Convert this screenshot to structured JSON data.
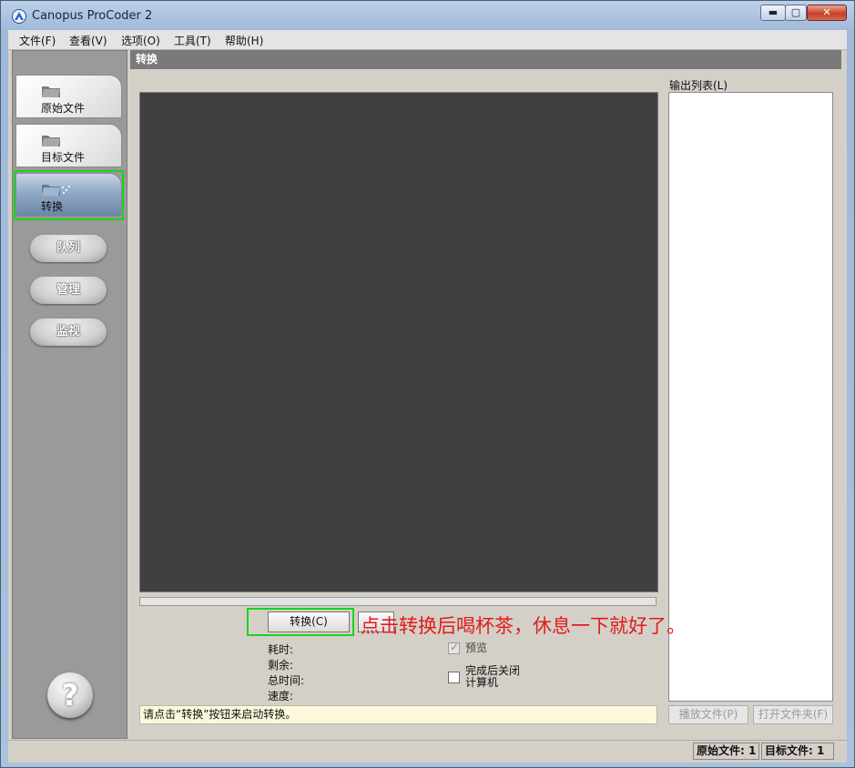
{
  "window": {
    "title": "Canopus ProCoder 2",
    "controls": {
      "minimize": "▬",
      "maximize": "▢",
      "close": "✕"
    }
  },
  "menu": [
    {
      "label": "文件(F)"
    },
    {
      "label": "查看(V)"
    },
    {
      "label": "选项(O)"
    },
    {
      "label": "工具(T)"
    },
    {
      "label": "帮助(H)"
    }
  ],
  "sidebar": {
    "tabs": [
      {
        "label": "原始文件",
        "icon": "folder-icon",
        "active": false
      },
      {
        "label": "目标文件",
        "icon": "folder-icon",
        "active": false
      },
      {
        "label": "转换",
        "icon": "folder-convert-icon",
        "active": true
      }
    ],
    "pills": [
      {
        "label": "队列"
      },
      {
        "label": "管理"
      },
      {
        "label": "监视"
      }
    ],
    "help": "?"
  },
  "main": {
    "header": "转换",
    "progress": 0,
    "convert_button": "转换(C)",
    "stats": {
      "elapsed": "耗时:",
      "remaining": "剩余:",
      "total": "总时间:",
      "speed": "速度:"
    },
    "options": {
      "preview": {
        "label": "预览",
        "checked": true
      },
      "shutdown": {
        "label_line1": "完成后关闭",
        "label_line2": "计算机",
        "checked": false
      }
    },
    "status_message": "请点击“转换”按钮来启动转换。",
    "output_list": {
      "label": "输出列表(L)",
      "play_button": "播放文件(P)",
      "open_folder_button": "打开文件夹(F)"
    }
  },
  "annotation": "点击转换后喝杯茶，休息一下就好了。",
  "statusbar": {
    "source": "原始文件: 1",
    "target": "目标文件: 1"
  },
  "colors": {
    "highlight": "#19d41c",
    "annotation": "#e21b1b",
    "preview_bg": "#404040"
  }
}
